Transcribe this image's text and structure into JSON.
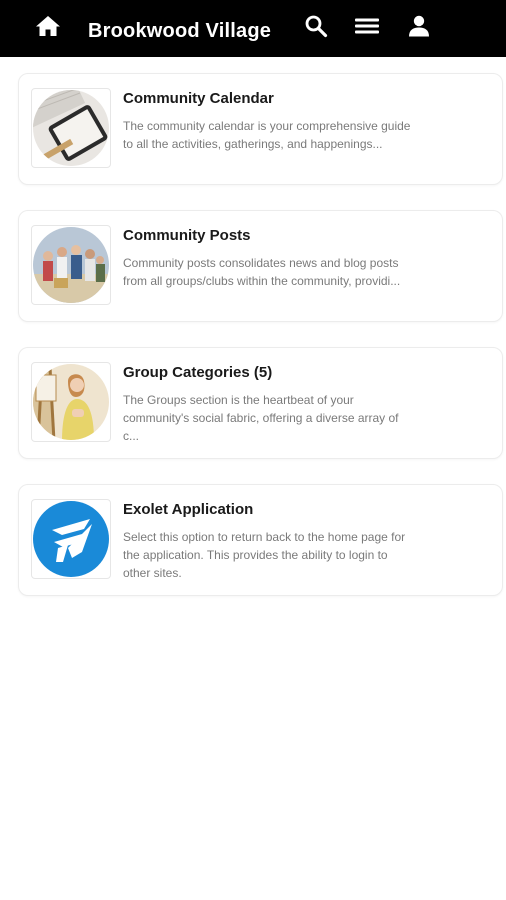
{
  "header": {
    "title": "Brookwood Village",
    "icons": [
      "home-icon",
      "search-icon",
      "menu-icon",
      "user-icon"
    ]
  },
  "cards": [
    {
      "title": "Community Calendar",
      "description": "The community calendar is your comprehensive guide to all the activities, gatherings, and happenings...",
      "thumbnail": "calendar-tablet-photo"
    },
    {
      "title": "Community Posts",
      "description": "Community posts consolidates news and blog posts from all groups/clubs within the community, providi...",
      "thumbnail": "people-group-photo"
    },
    {
      "title": "Group Categories (5)",
      "description": "The Groups section is the heartbeat of your community's social fabric, offering a diverse array of c...",
      "thumbnail": "painter-easel-photo"
    },
    {
      "title": "Exolet Application",
      "description": "Select this option to return back to the home page for the application. This provides the ability to login to other sites.",
      "thumbnail": "exolet-logo"
    }
  ],
  "colors": {
    "header_bg": "#000000",
    "header_text": "#ffffff",
    "card_title": "#1a1a1a",
    "card_desc": "#7a7a7a",
    "logo_blue": "#1a8ad8"
  }
}
